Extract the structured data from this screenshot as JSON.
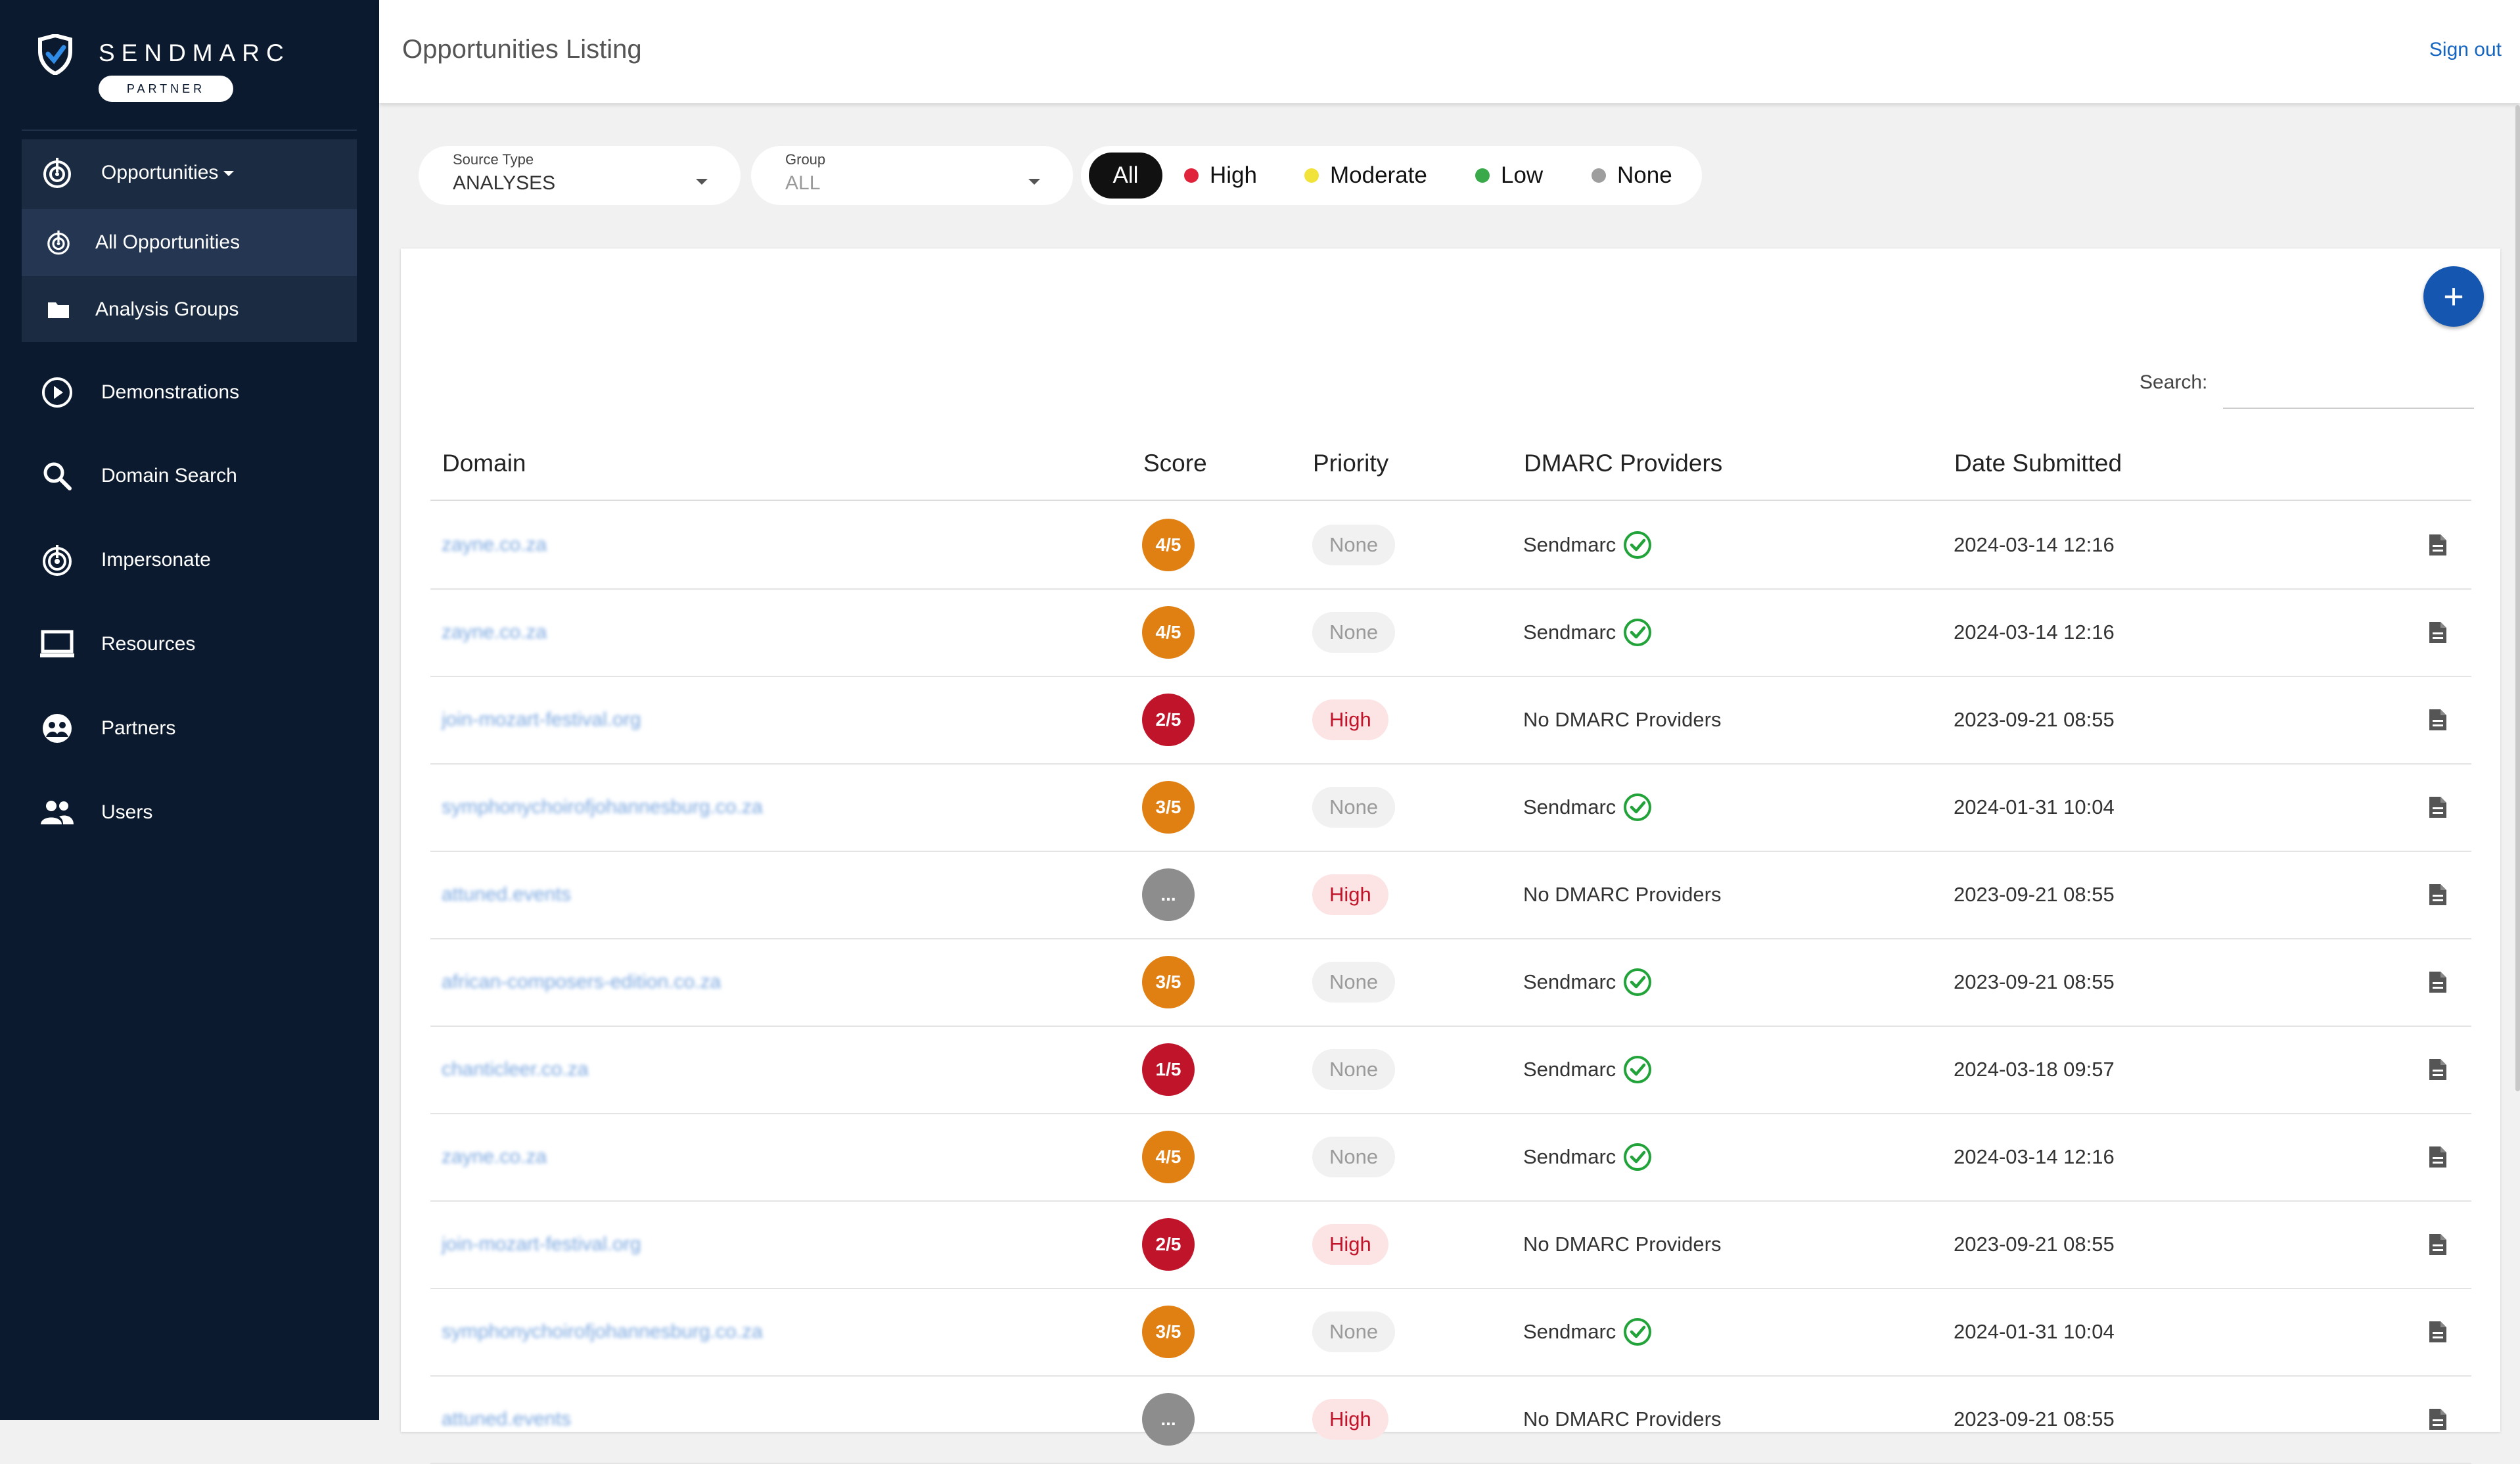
{
  "brand": {
    "name": "SENDMARC",
    "badge": "PARTNER"
  },
  "sidebar": {
    "items": [
      {
        "id": "opportunities",
        "label": "Opportunities",
        "icon": "target-icon"
      },
      {
        "id": "all-opportunities",
        "label": "All Opportunities",
        "icon": "target-icon"
      },
      {
        "id": "analysis-groups",
        "label": "Analysis Groups",
        "icon": "folder-icon"
      },
      {
        "id": "demonstrations",
        "label": "Demonstrations",
        "icon": "play-circle-icon"
      },
      {
        "id": "domain-search",
        "label": "Domain Search",
        "icon": "search-icon"
      },
      {
        "id": "impersonate",
        "label": "Impersonate",
        "icon": "fingerprint-icon"
      },
      {
        "id": "resources",
        "label": "Resources",
        "icon": "laptop-icon"
      },
      {
        "id": "partners",
        "label": "Partners",
        "icon": "partners-icon"
      },
      {
        "id": "users",
        "label": "Users",
        "icon": "users-icon"
      }
    ]
  },
  "header": {
    "title": "Opportunities Listing",
    "signout": "Sign out"
  },
  "filters": {
    "source_type": {
      "caption": "Source Type",
      "value": "ANALYSES"
    },
    "group": {
      "caption": "Group",
      "value": "ALL"
    },
    "priority": [
      {
        "label": "All",
        "color": "#111111"
      },
      {
        "label": "High",
        "color": "#e0243b"
      },
      {
        "label": "Moderate",
        "color": "#f2e33b"
      },
      {
        "label": "Low",
        "color": "#3aa94a"
      },
      {
        "label": "None",
        "color": "#9e9e9e"
      }
    ]
  },
  "table": {
    "search_label": "Search:",
    "search_value": "",
    "add_label": "+",
    "columns": [
      "Domain",
      "Score",
      "Priority",
      "DMARC Providers",
      "Date Submitted"
    ],
    "rows": [
      {
        "domain": "zayne.co.za",
        "score": "4/5",
        "score_color": "#e07f12",
        "priority": "None",
        "provider": "Sendmarc",
        "verified": true,
        "date": "2024-03-14 12:16"
      },
      {
        "domain": "zayne.co.za",
        "score": "4/5",
        "score_color": "#e07f12",
        "priority": "None",
        "provider": "Sendmarc",
        "verified": true,
        "date": "2024-03-14 12:16"
      },
      {
        "domain": "join-mozart-festival.org",
        "score": "2/5",
        "score_color": "#c0142b",
        "priority": "High",
        "provider": "No DMARC Providers",
        "verified": false,
        "date": "2023-09-21 08:55"
      },
      {
        "domain": "symphonychoirofjohannesburg.co.za",
        "score": "3/5",
        "score_color": "#e07f12",
        "priority": "None",
        "provider": "Sendmarc",
        "verified": true,
        "date": "2024-01-31 10:04"
      },
      {
        "domain": "attuned.events",
        "score": "...",
        "score_color": "#8d8d8d",
        "priority": "High",
        "provider": "No DMARC Providers",
        "verified": false,
        "date": "2023-09-21 08:55"
      },
      {
        "domain": "african-composers-edition.co.za",
        "score": "3/5",
        "score_color": "#e07f12",
        "priority": "None",
        "provider": "Sendmarc",
        "verified": true,
        "date": "2023-09-21 08:55"
      },
      {
        "domain": "chanticleer.co.za",
        "score": "1/5",
        "score_color": "#c0142b",
        "priority": "None",
        "provider": "Sendmarc",
        "verified": true,
        "date": "2024-03-18 09:57"
      },
      {
        "domain": "zayne.co.za",
        "score": "4/5",
        "score_color": "#e07f12",
        "priority": "None",
        "provider": "Sendmarc",
        "verified": true,
        "date": "2024-03-14 12:16"
      },
      {
        "domain": "join-mozart-festival.org",
        "score": "2/5",
        "score_color": "#c0142b",
        "priority": "High",
        "provider": "No DMARC Providers",
        "verified": false,
        "date": "2023-09-21 08:55"
      },
      {
        "domain": "symphonychoirofjohannesburg.co.za",
        "score": "3/5",
        "score_color": "#e07f12",
        "priority": "None",
        "provider": "Sendmarc",
        "verified": true,
        "date": "2024-01-31 10:04"
      },
      {
        "domain": "attuned.events",
        "score": "...",
        "score_color": "#8d8d8d",
        "priority": "High",
        "provider": "No DMARC Providers",
        "verified": false,
        "date": "2023-09-21 08:55"
      }
    ]
  }
}
